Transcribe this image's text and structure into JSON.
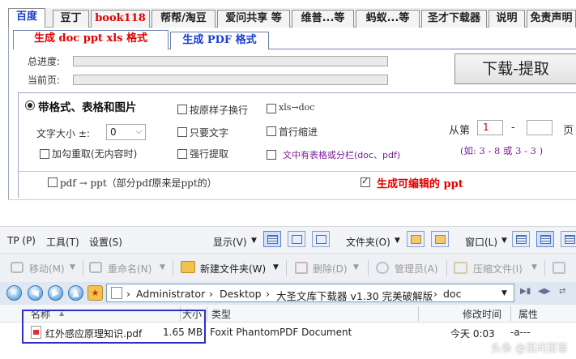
{
  "tabs": [
    "百度",
    "豆丁",
    "book118",
    "帮帮/淘豆",
    "爱问共享 等",
    "维普...等",
    "蚂蚁...等",
    "圣才下载器",
    "说明",
    "免责声明"
  ],
  "subtabs": [
    "生成 doc ppt xls 格式",
    "生成 PDF 格式"
  ],
  "progress": {
    "total_label": "总进度:",
    "current_label": "当前页:",
    "total_value": 0,
    "current_value": 0
  },
  "download_button": "下载-提取",
  "options": {
    "mode_label": "带格式、表格和图片",
    "font_size_label": "文字大小 ±:",
    "font_size_value": "0",
    "line_break": "按原样子换行",
    "xls_to_doc": "xls→doc",
    "text_only": "只要文字",
    "first_indent": "首行缩进",
    "repaint": "加勾重取(无内容时)",
    "force_extract": "强行提取",
    "table_note": "文中有表格或分栏(doc、pdf)",
    "from_label": "从第",
    "from_value": "1",
    "dash": "-",
    "to_value": "",
    "page_suffix": "页",
    "example": "(如: 3 - 8  或 3 - 3 )",
    "pdf_to_ppt": "pdf → ppt（部分pdf原来是ppt的）",
    "editable_ppt": "生成可编辑的 ppt"
  },
  "explorer": {
    "menu": [
      "TP (P)",
      "工具(T)",
      "设置(S)",
      "显示(V)",
      "文件夹(O)",
      "窗口(L)"
    ],
    "toolbar": [
      "移动(M)",
      "重命名(N)",
      "新建文件夹(W)",
      "删除(D)",
      "管理员(A)",
      "压缩文件(I)"
    ],
    "breadcrumb": [
      "Administrator",
      "Desktop",
      "大圣文库下载器 v1.30 完美破解版",
      "doc"
    ],
    "columns": [
      "名称",
      "大小",
      "类型",
      "修改时间",
      "属性"
    ],
    "files": [
      {
        "name": "红外感应原理知识.pdf",
        "size": "1.65 MB",
        "type": "Foxit PhantomPDF Document",
        "modified": "今天 0:03",
        "attr": "-a---"
      }
    ]
  },
  "watermark": "头条 @百问百答",
  "colors": {
    "accent_red": "#e00000",
    "accent_blue": "#1a3fd0",
    "highlight_box": "#2b2fc8"
  }
}
